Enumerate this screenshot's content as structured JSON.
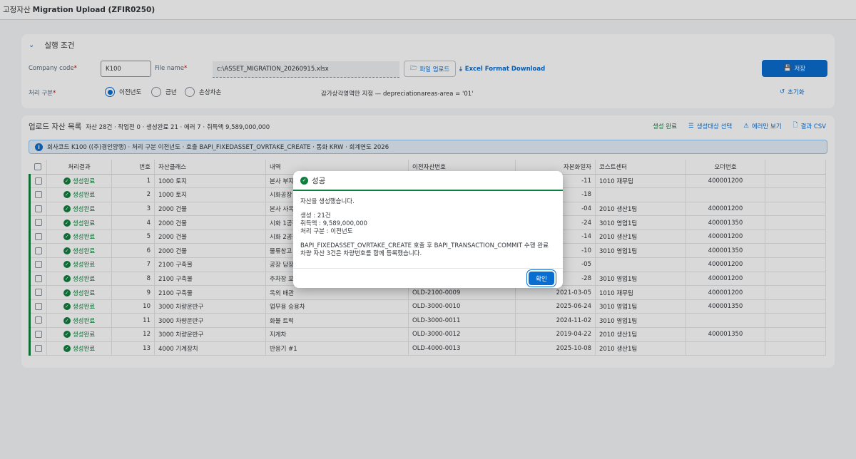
{
  "header": {
    "title_prefix": "고정자산",
    "title_main": "Migration Upload (ZFIR0250)"
  },
  "conditions": {
    "section_title": "실행 조건",
    "company_code_label": "Company code",
    "company_code_value": "K100",
    "file_name_label": "File name",
    "file_name_value": "c:\\ASSET_MIGRATION_20260915.xlsx",
    "upload_button": "파일 업로드",
    "template_link": "Excel Format Download",
    "save_button": "저장",
    "process_type_label": "처리 구분",
    "radio_options": [
      "이전년도",
      "금년",
      "손상차손"
    ],
    "selected_radio": "이전년도",
    "area_note": "감가상각영역만 지정 — depreciationareas-area = '01'",
    "reset_button": "초기화",
    "required_mark": "*"
  },
  "list": {
    "title": "업로드 자산 목록",
    "summary": "자산 28건 · 작업전 0 · 생성완료 21 · 에러 7 · 취득액 9,589,000,000",
    "actions": [
      "생성 완료",
      "생성대상 선택",
      "에러만 보기",
      "결과 CSV"
    ],
    "info": "회사코드 K100 ((주)경인양행) · 처리 구분 이전년도 · 호출 BAPI_FIXEDASSET_OVRTAKE_CREATE · 통화 KRW · 회계연도 2026",
    "columns": [
      "처리결과",
      "번호",
      "자산클래스",
      "내역",
      "이전자산번호",
      "자본화일자",
      "코스트센터",
      "오더번호"
    ],
    "rows": [
      {
        "status": "생성완료",
        "no": "1",
        "class": "1000 토지",
        "desc": "본사 부지",
        "old": "",
        "date": "-11",
        "cc": "1010 재무팀",
        "order": "400001200"
      },
      {
        "status": "생성완료",
        "no": "2",
        "class": "1000 토지",
        "desc": "시화공장",
        "old": "",
        "date": "-18",
        "cc": "",
        "order": ""
      },
      {
        "status": "생성완료",
        "no": "3",
        "class": "2000 건물",
        "desc": "본사 사옥",
        "old": "",
        "date": "-04",
        "cc": "2010 생산1팀",
        "order": "400001200"
      },
      {
        "status": "생성완료",
        "no": "4",
        "class": "2000 건물",
        "desc": "시화 1공장",
        "old": "",
        "date": "-24",
        "cc": "3010 영업1팀",
        "order": "400001350"
      },
      {
        "status": "생성완료",
        "no": "5",
        "class": "2000 건물",
        "desc": "시화 2공장",
        "old": "",
        "date": "-14",
        "cc": "2010 생산1팀",
        "order": "400001200"
      },
      {
        "status": "생성완료",
        "no": "6",
        "class": "2000 건물",
        "desc": "물류창고",
        "old": "",
        "date": "-10",
        "cc": "3010 영업1팀",
        "order": "400001350"
      },
      {
        "status": "생성완료",
        "no": "7",
        "class": "2100 구축물",
        "desc": "공장 담장",
        "old": "",
        "date": "-05",
        "cc": "",
        "order": "400001200"
      },
      {
        "status": "생성완료",
        "no": "8",
        "class": "2100 구축물",
        "desc": "주차장 포",
        "old": "",
        "date": "-28",
        "cc": "3010 영업1팀",
        "order": "400001200"
      },
      {
        "status": "생성완료",
        "no": "9",
        "class": "2100 구축물",
        "desc": "옥외 배관",
        "old": "OLD-2100-0009",
        "date": "2021-03-05",
        "cc": "1010 재무팀",
        "order": "400001200"
      },
      {
        "status": "생성완료",
        "no": "10",
        "class": "3000 차량운반구",
        "desc": "업무용 승용차",
        "old": "OLD-3000-0010",
        "date": "2025-06-24",
        "cc": "3010 영업1팀",
        "order": "400001350"
      },
      {
        "status": "생성완료",
        "no": "11",
        "class": "3000 차량운반구",
        "desc": "화물 트럭",
        "old": "OLD-3000-0011",
        "date": "2024-11-02",
        "cc": "3010 영업1팀",
        "order": ""
      },
      {
        "status": "생성완료",
        "no": "12",
        "class": "3000 차량운반구",
        "desc": "지게차",
        "old": "OLD-3000-0012",
        "date": "2019-04-22",
        "cc": "2010 생산1팀",
        "order": "400001350"
      },
      {
        "status": "생성완료",
        "no": "13",
        "class": "4000 기계장치",
        "desc": "반응기 #1",
        "old": "OLD-4000-0013",
        "date": "2025-10-08",
        "cc": "2010 생산1팀",
        "order": ""
      }
    ]
  },
  "dialog": {
    "title": "성공",
    "line1": "자산을 생성했습니다.",
    "line2": "생성 : 21건",
    "line3": "취득액 : 9,589,000,000",
    "line4": "처리 구분 : 이전년도",
    "line5": "BAPI_FIXEDASSET_OVRTAKE_CREATE 호출 후 BAPI_TRANSACTION_COMMIT 수행 완료",
    "line6": "차량 자산 3건은 차량번호를 함께 등록했습니다.",
    "ok_button": "확인"
  },
  "colors": {
    "accent": "#0a6ed1",
    "success": "#107e3e",
    "error": "#bb0000"
  },
  "icons": [
    "chevron-down-icon",
    "folder-icon",
    "download-icon",
    "save-icon",
    "reset-icon",
    "list-icon",
    "warning-icon",
    "export-icon",
    "info-icon",
    "success-icon"
  ]
}
